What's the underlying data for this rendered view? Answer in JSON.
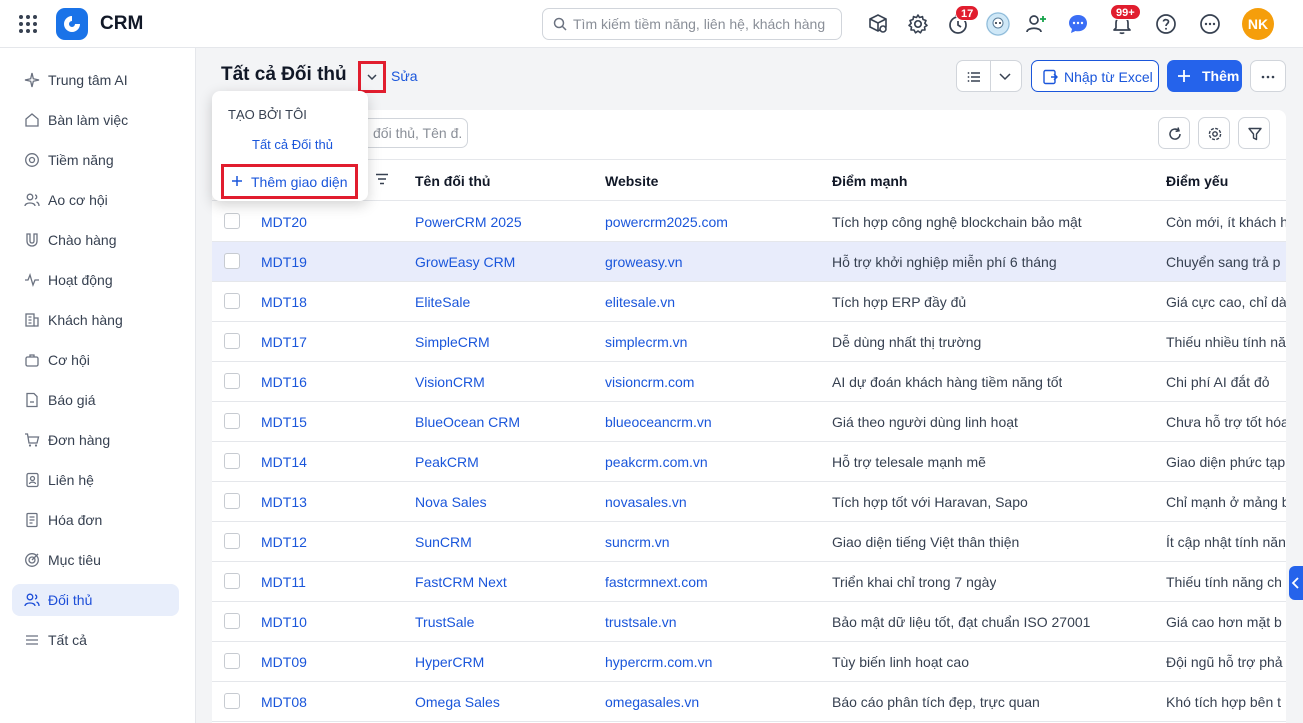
{
  "app": {
    "name": "CRM"
  },
  "search": {
    "placeholder": "Tìm kiếm tiềm năng, liên hệ, khách hàng"
  },
  "header": {
    "badges": {
      "reminders": "17",
      "notifications": "99+"
    },
    "user_initials": "NK",
    "icons": [
      "apps-grid-icon",
      "package-search-icon",
      "gear-icon",
      "clock-icon",
      "bot-avatar",
      "add-user-icon",
      "chat-icon",
      "bell-icon",
      "help-icon",
      "more-icon"
    ]
  },
  "sidebar": {
    "items": [
      {
        "label": "Trung tâm AI",
        "icon": "sparkle-icon"
      },
      {
        "label": "Bàn làm việc",
        "icon": "home-icon"
      },
      {
        "label": "Tiềm năng",
        "icon": "target-icon"
      },
      {
        "label": "Ao cơ hội",
        "icon": "users-icon"
      },
      {
        "label": "Chào hàng",
        "icon": "magnet-icon"
      },
      {
        "label": "Hoạt động",
        "icon": "activity-icon"
      },
      {
        "label": "Khách hàng",
        "icon": "building-icon"
      },
      {
        "label": "Cơ hội",
        "icon": "briefcase-icon"
      },
      {
        "label": "Báo giá",
        "icon": "quote-icon"
      },
      {
        "label": "Đơn hàng",
        "icon": "cart-icon"
      },
      {
        "label": "Liên hệ",
        "icon": "contact-icon"
      },
      {
        "label": "Hóa đơn",
        "icon": "invoice-icon"
      },
      {
        "label": "Mục tiêu",
        "icon": "goal-icon"
      },
      {
        "label": "Đối thủ",
        "icon": "competitor-icon",
        "active": true
      },
      {
        "label": "Tất cả",
        "icon": "menu-icon"
      }
    ]
  },
  "page": {
    "title": "Tất cả Đối thủ",
    "edit_label": "Sửa",
    "import_label": "Nhập từ Excel",
    "add_label": "Thêm",
    "table_search_placeholder": "đối thủ, Tên đ..."
  },
  "view_dropdown": {
    "section_title": "TẠO BỞI TÔI",
    "item": "Tất cả Đối thủ",
    "add_view_label": "Thêm giao diện"
  },
  "table": {
    "columns": [
      "Tên đối thủ",
      "Website",
      "Điểm mạnh",
      "Điểm yếu"
    ],
    "rows": [
      {
        "code": "MDT20",
        "name": "PowerCRM 2025",
        "website": "powercrm2025.com",
        "strength": "Tích hợp công nghệ blockchain bảo mật",
        "weakness": "Còn mới, ít khách h"
      },
      {
        "code": "MDT19",
        "name": "GrowEasy CRM",
        "website": "groweasy.vn",
        "strength": "Hỗ trợ khởi nghiệp miễn phí 6 tháng",
        "weakness": "Chuyển sang trả p"
      },
      {
        "code": "MDT18",
        "name": "EliteSale",
        "website": "elitesale.vn",
        "strength": "Tích hợp ERP đầy đủ",
        "weakness": "Giá cực cao, chỉ dà"
      },
      {
        "code": "MDT17",
        "name": "SimpleCRM",
        "website": "simplecrm.vn",
        "strength": "Dễ dùng nhất thị trường",
        "weakness": "Thiếu nhiều tính nă"
      },
      {
        "code": "MDT16",
        "name": "VisionCRM",
        "website": "visioncrm.com",
        "strength": "AI dự đoán khách hàng tiềm năng tốt",
        "weakness": "Chi phí AI đắt đỏ"
      },
      {
        "code": "MDT15",
        "name": "BlueOcean CRM",
        "website": "blueoceancrm.vn",
        "strength": "Giá theo người dùng linh hoạt",
        "weakness": "Chưa hỗ trợ tốt hóa"
      },
      {
        "code": "MDT14",
        "name": "PeakCRM",
        "website": "peakcrm.com.vn",
        "strength": "Hỗ trợ telesale mạnh mẽ",
        "weakness": "Giao diện phức tạp"
      },
      {
        "code": "MDT13",
        "name": "Nova Sales",
        "website": "novasales.vn",
        "strength": "Tích hợp tốt với Haravan, Sapo",
        "weakness": "Chỉ mạnh ở mảng b"
      },
      {
        "code": "MDT12",
        "name": "SunCRM",
        "website": "suncrm.vn",
        "strength": "Giao diện tiếng Việt thân thiện",
        "weakness": "Ít cập nhật tính năn"
      },
      {
        "code": "MDT11",
        "name": "FastCRM Next",
        "website": "fastcrmnext.com",
        "strength": "Triển khai chỉ trong 7 ngày",
        "weakness": "Thiếu tính năng ch"
      },
      {
        "code": "MDT10",
        "name": "TrustSale",
        "website": "trustsale.vn",
        "strength": "Bảo mật dữ liệu tốt, đạt chuẩn ISO 27001",
        "weakness": "Giá cao hơn mặt b"
      },
      {
        "code": "MDT09",
        "name": "HyperCRM",
        "website": "hypercrm.com.vn",
        "strength": "Tùy biến linh hoạt cao",
        "weakness": "Đội ngũ hỗ trợ phả"
      },
      {
        "code": "MDT08",
        "name": "Omega Sales",
        "website": "omegasales.vn",
        "strength": "Báo cáo phân tích đẹp, trực quan",
        "weakness": "Khó tích hợp bên t"
      }
    ],
    "highlighted_row": "MDT19"
  },
  "colors": {
    "accent": "#2563eb",
    "link": "#1a56db",
    "badge": "#e11d2e",
    "avatar": "#f59e0b",
    "highlight": "#e8ecfb"
  }
}
